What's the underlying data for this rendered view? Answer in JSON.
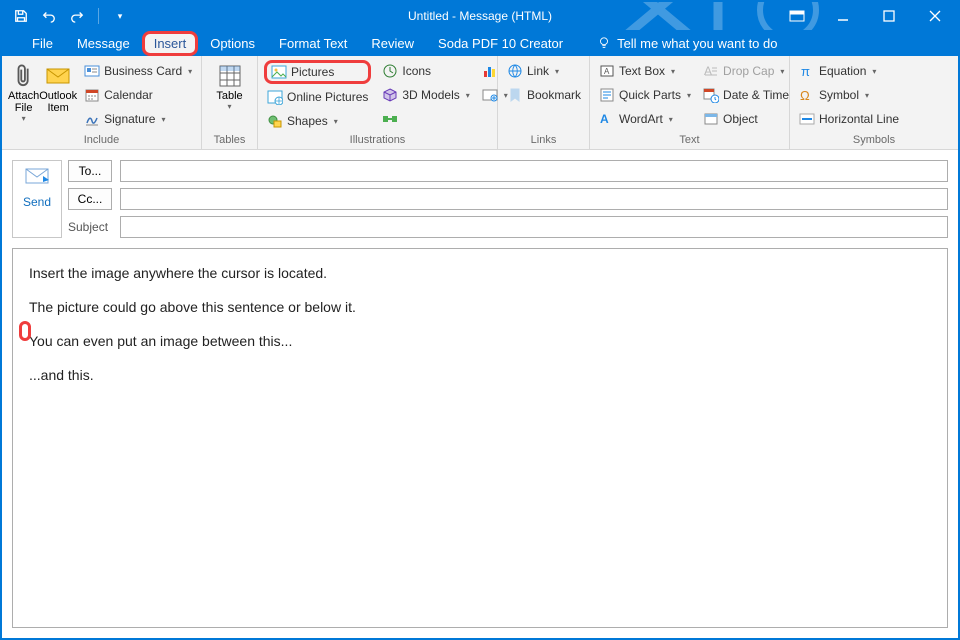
{
  "titlebar": {
    "title": "Untitled - Message (HTML)"
  },
  "tabs": {
    "file": "File",
    "message": "Message",
    "insert": "Insert",
    "options": "Options",
    "format_text": "Format Text",
    "review": "Review",
    "soda": "Soda PDF 10 Creator",
    "tellme": "Tell me what you want to do"
  },
  "ribbon": {
    "include": {
      "label": "Include",
      "attach_file": "Attach File",
      "outlook_item": "Outlook Item",
      "business_card": "Business Card",
      "calendar": "Calendar",
      "signature": "Signature"
    },
    "tables": {
      "label": "Tables",
      "table": "Table"
    },
    "illustrations": {
      "label": "Illustrations",
      "pictures": "Pictures",
      "online_pictures": "Online Pictures",
      "shapes": "Shapes",
      "icons": "Icons",
      "models": "3D Models",
      "smartart": "",
      "chart": "",
      "screenshot": ""
    },
    "links": {
      "label": "Links",
      "link": "Link",
      "bookmark": "Bookmark"
    },
    "text": {
      "label": "Text",
      "text_box": "Text Box",
      "quick_parts": "Quick Parts",
      "wordart": "WordArt",
      "drop_cap": "Drop Cap",
      "date_time": "Date & Time",
      "object": "Object"
    },
    "symbols": {
      "label": "Symbols",
      "equation": "Equation",
      "symbol": "Symbol",
      "hline": "Horizontal Line"
    }
  },
  "compose": {
    "send": "Send",
    "to": "To...",
    "cc": "Cc...",
    "subject": "Subject"
  },
  "body": {
    "l1": "Insert the image anywhere the cursor is located.",
    "l2": "The picture could go above this sentence or below it.",
    "l3": "You can even put an image between this...",
    "l4": "...and this."
  }
}
